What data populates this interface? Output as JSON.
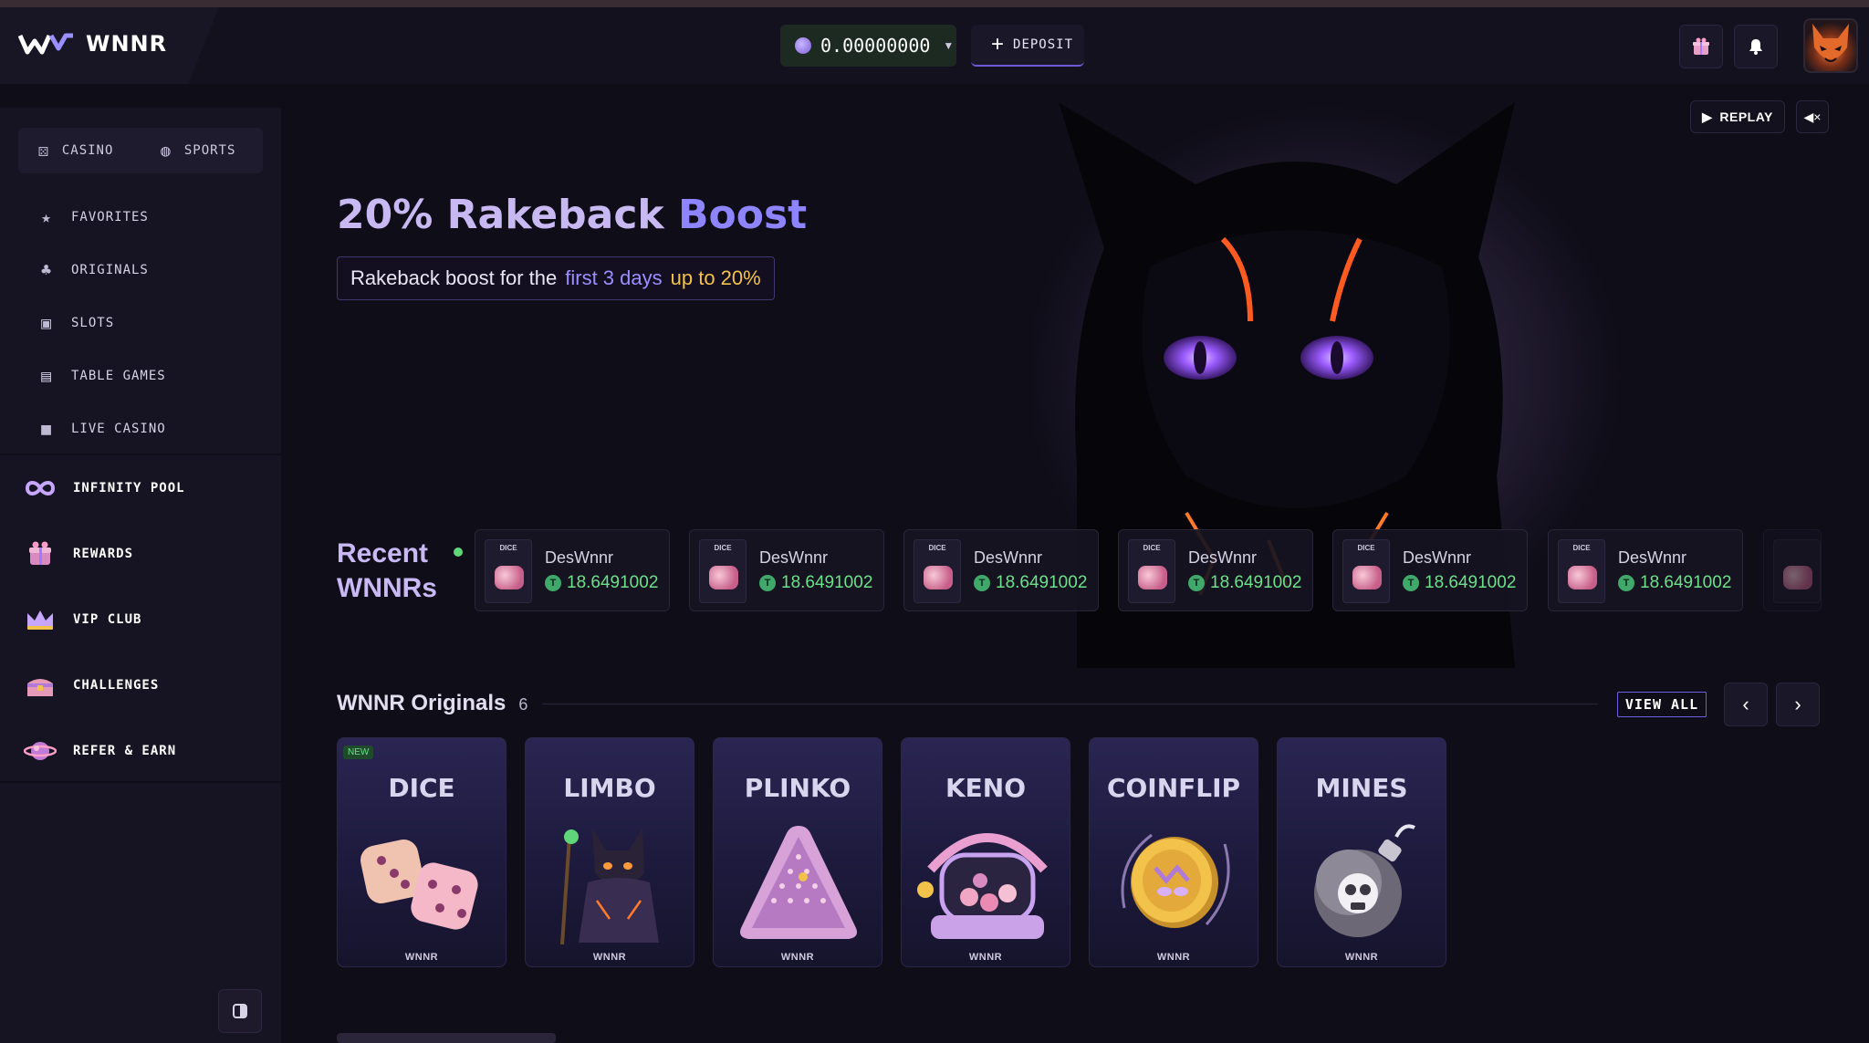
{
  "header": {
    "logo_text": "WNNR",
    "balance": "0.00000000",
    "deposit_label": "DEPOSIT"
  },
  "sidebar": {
    "toggle": [
      {
        "label": "CASINO",
        "icon": "dice-icon"
      },
      {
        "label": "SPORTS",
        "icon": "basketball-icon"
      }
    ],
    "items": [
      {
        "label": "FAVORITES",
        "icon": "star-icon"
      },
      {
        "label": "ORIGINALS",
        "icon": "clover-icon"
      },
      {
        "label": "SLOTS",
        "icon": "slot-machine-icon"
      },
      {
        "label": "TABLE GAMES",
        "icon": "cards-icon"
      },
      {
        "label": "LIVE CASINO",
        "icon": "camera-icon"
      }
    ],
    "promo_items": [
      {
        "label": "INFINITY POOL",
        "icon": "infinity-icon"
      },
      {
        "label": "REWARDS",
        "icon": "gift-icon"
      },
      {
        "label": "VIP CLUB",
        "icon": "crown-icon"
      },
      {
        "label": "CHALLENGES",
        "icon": "treasure-icon"
      },
      {
        "label": "REFER & EARN",
        "icon": "planet-icon"
      }
    ]
  },
  "hero": {
    "replay_label": "REPLAY",
    "title_part1": "20% Rakeback",
    "title_part2": "Boost",
    "sub_part1": "Rakeback boost for the",
    "sub_highlight": "first 3 days",
    "sub_gold": "up to 20%"
  },
  "recent": {
    "title_line1": "Recent",
    "title_line2": "WNNRs",
    "wins": [
      {
        "user": "DesWnnr",
        "amount": "18.6491002",
        "game_tag": "DICE"
      },
      {
        "user": "DesWnnr",
        "amount": "18.6491002",
        "game_tag": "DICE"
      },
      {
        "user": "DesWnnr",
        "amount": "18.6491002",
        "game_tag": "DICE"
      },
      {
        "user": "DesWnnr",
        "amount": "18.6491002",
        "game_tag": "DICE"
      },
      {
        "user": "DesWnnr",
        "amount": "18.6491002",
        "game_tag": "DICE"
      },
      {
        "user": "DesWnnr",
        "amount": "18.6491002",
        "game_tag": "DICE"
      }
    ]
  },
  "originals": {
    "title": "WNNR Originals",
    "count": "6",
    "view_all_label": "VIEW ALL",
    "games": [
      {
        "name": "DICE",
        "brand": "WNNR",
        "badge": "NEW"
      },
      {
        "name": "LIMBO",
        "brand": "WNNR"
      },
      {
        "name": "PLINKO",
        "brand": "WNNR"
      },
      {
        "name": "KENO",
        "brand": "WNNR"
      },
      {
        "name": "COINFLIP",
        "brand": "WNNR"
      },
      {
        "name": "MINES",
        "brand": "WNNR"
      }
    ]
  },
  "colors": {
    "accent": "#8f84ff",
    "gold": "#f2c24a",
    "win_green": "#6ce08a",
    "background": "#0f0d18"
  }
}
